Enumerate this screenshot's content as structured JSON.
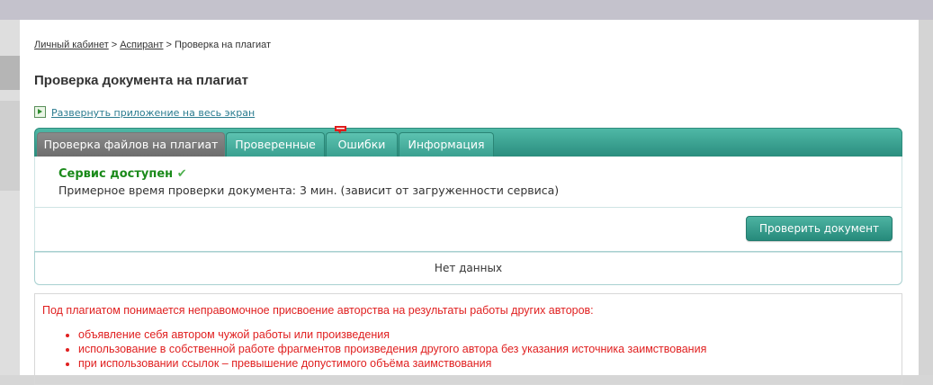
{
  "breadcrumb": {
    "home": "Личный кабинет",
    "section": "Аспирант",
    "current": "Проверка на плагиат",
    "separator": ">"
  },
  "page_title": "Проверка документа на плагиат",
  "expand_link": {
    "icon": "expand-icon",
    "label": "Развернуть приложение на весь экран"
  },
  "tabs": [
    {
      "label": "Проверка файлов на плагиат"
    },
    {
      "label": "Проверенные"
    },
    {
      "label": "Ошибки",
      "badge_icon": "new-badge-icon"
    },
    {
      "label": "Информация"
    }
  ],
  "status": {
    "title": "Сервис доступен",
    "check_icon": "✔",
    "estimate": "Примерное время проверки документа: 3 мин. (зависит от загруженности сервиса)"
  },
  "actions": {
    "check_button": "Проверить документ"
  },
  "empty_text": "Нет данных",
  "info": {
    "lead": "Под плагиатом понимается неправомочное присвоение авторства на результаты работы других авторов:",
    "items": [
      "объявление себя автором чужой работы или произведения",
      "использование в собственной работе фрагментов произведения другого автора без указания источника заимствования",
      "при использовании ссылок – превышение допустимого объёма заимствования"
    ]
  },
  "colors": {
    "accent": "#2c8f80",
    "success": "#1a8a1a",
    "warning_text": "#e02020"
  }
}
